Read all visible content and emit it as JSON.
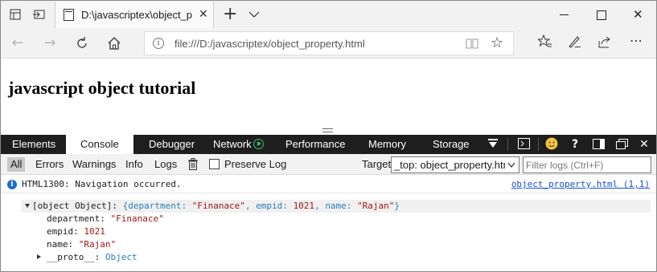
{
  "window": {
    "tab_title": "D:\\javascriptex\\object_p",
    "address": "file:///D:/javascriptex/object_property.html"
  },
  "page": {
    "heading": "javascript object tutorial"
  },
  "devtools": {
    "tabs": [
      "Elements",
      "Console",
      "Debugger",
      "Network",
      "Performance",
      "Memory",
      "Storage"
    ],
    "active_tab": "Console",
    "filters": [
      "All",
      "Errors",
      "Warnings",
      "Info",
      "Logs"
    ],
    "active_filter": "All",
    "preserve_log_label": "Preserve Log",
    "target_label": "Target",
    "target_value": "_top: object_property.htm",
    "filter_placeholder": "Filter logs (Ctrl+F)"
  },
  "console": {
    "message": {
      "text": "HTML1300: Navigation occurred.",
      "source": "object_property.html (1,1)"
    },
    "object_summary_prefix": "[object Object]:",
    "object_summary": {
      "open": "{",
      "department_key": "department:",
      "department_val": "\"Finanace\"",
      "empid_key": "empid:",
      "empid_val": "1021",
      "name_key": "name:",
      "name_val": "\"Rajan\"",
      "close": "}"
    },
    "properties": [
      {
        "key": "department:",
        "value": "\"Finanace\""
      },
      {
        "key": "empid:",
        "value": "1021"
      },
      {
        "key": "name:",
        "value": "\"Rajan\""
      }
    ],
    "proto": {
      "key": "__proto__:",
      "value": "Object"
    }
  },
  "colors": {
    "devtools_bar": "#1e1e1e",
    "string_value": "#a31515",
    "type_value": "#2b7fb8",
    "link": "#1a4fd1",
    "info_icon": "#1a6fcf",
    "network_icon": "#36c46f"
  }
}
